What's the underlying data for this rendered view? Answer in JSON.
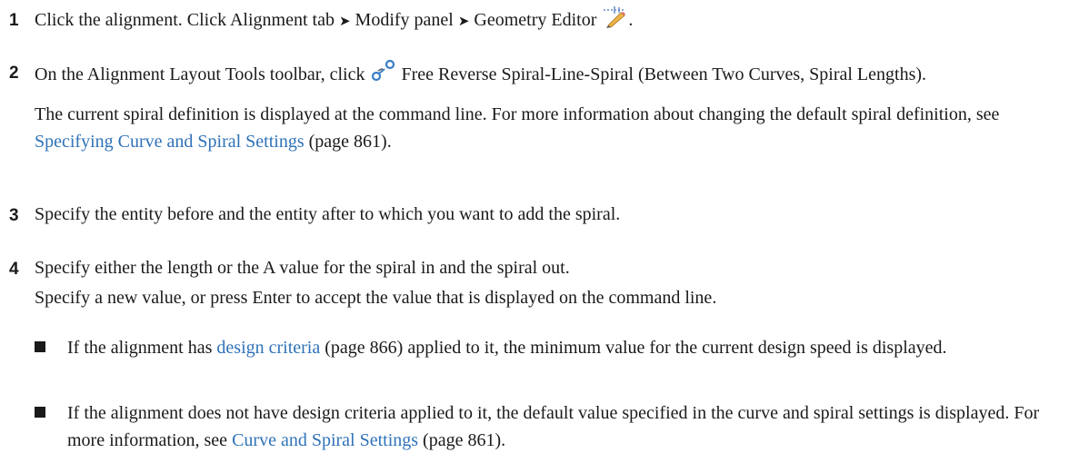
{
  "steps": [
    {
      "number": "1",
      "text_a": "Click the alignment. Click Alignment tab ",
      "arrow": "➤",
      "text_b": " Modify panel ",
      "text_c": " Geometry Editor ",
      "text_end": ".",
      "icon": "geometry-editor-icon"
    },
    {
      "number": "2",
      "text_a": "On the Alignment Layout Tools toolbar, click ",
      "text_b": " Free Reverse Spiral-Line-Spiral (Between Two Curves, Spiral Lengths).",
      "icon": "spiral-line-spiral-icon",
      "para2_a": "The current spiral definition is displayed at the command line. For more information about changing the default spiral definition, see ",
      "para2_link": "Specifying Curve and Spiral Settings",
      "para2_ref": " (page 861)."
    },
    {
      "number": "3",
      "text": "Specify the entity before and the entity after to which you want to add the spiral."
    },
    {
      "number": "4",
      "text": "Specify either the length or the A value for the spiral in and the spiral out.",
      "para2": "Specify a new value, or press Enter to accept the value that is displayed on the command line.",
      "bullets": [
        {
          "pre": "If the alignment has ",
          "link": "design criteria",
          "post": " (page 866) applied to it, the minimum value for the current design speed is displayed."
        },
        {
          "pre": "If the alignment does not have design criteria applied to it, the default value specified in the curve and spiral settings is displayed. For more information, see ",
          "link": "Curve and Spiral Settings",
          "post": " (page 861)."
        }
      ]
    }
  ],
  "colors": {
    "link": "#2f72b8",
    "text": "#1a1a1a"
  }
}
